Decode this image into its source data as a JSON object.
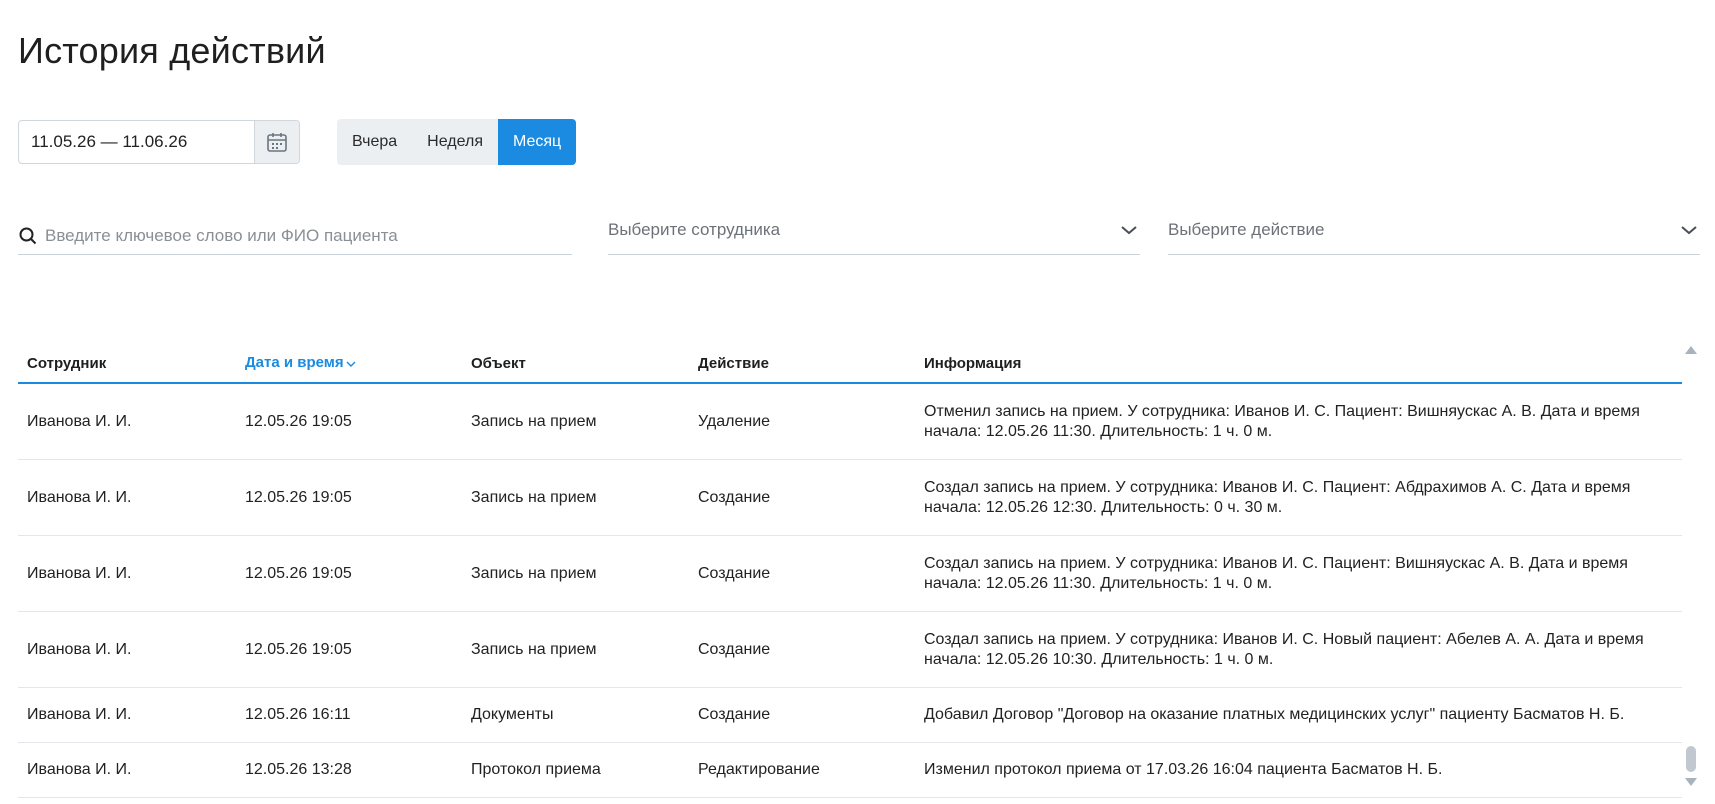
{
  "page": {
    "title": "История действий"
  },
  "filters": {
    "date_range": "11.05.26 — 11.06.26",
    "periods": [
      {
        "label": "Вчера",
        "active": false
      },
      {
        "label": "Неделя",
        "active": false
      },
      {
        "label": "Месяц",
        "active": true
      }
    ],
    "search_placeholder": "Введите ключевое слово или ФИО пациента",
    "employee_placeholder": "Выберите сотрудника",
    "action_placeholder": "Выберите действие"
  },
  "table": {
    "headers": {
      "employee": "Сотрудник",
      "datetime": "Дата и время",
      "object": "Объект",
      "action": "Действие",
      "info": "Информация"
    },
    "rows": [
      {
        "employee": "Иванова И. И.",
        "datetime": "12.05.26 19:05",
        "object": "Запись на прием",
        "action": "Удаление",
        "info": "Отменил запись на прием. У сотрудника: Иванов И. С. Пациент: Вишняускас А. В. Дата и время начала: 12.05.26 11:30. Длительность: 1 ч. 0 м."
      },
      {
        "employee": "Иванова И. И.",
        "datetime": "12.05.26 19:05",
        "object": "Запись на прием",
        "action": "Создание",
        "info": "Создал запись на прием. У сотрудника: Иванов И. С. Пациент: Абдрахимов А. С. Дата и время начала: 12.05.26 12:30. Длительность: 0 ч. 30 м."
      },
      {
        "employee": "Иванова И. И.",
        "datetime": "12.05.26 19:05",
        "object": "Запись на прием",
        "action": "Создание",
        "info": "Создал запись на прием. У сотрудника: Иванов И. С. Пациент: Вишняускас А. В. Дата и время начала: 12.05.26 11:30. Длительность: 1 ч. 0 м."
      },
      {
        "employee": "Иванова И. И.",
        "datetime": "12.05.26 19:05",
        "object": "Запись на прием",
        "action": "Создание",
        "info": "Создал запись на прием. У сотрудника: Иванов И. С. Новый пациент: Абелев А. А. Дата и время начала: 12.05.26 10:30. Длительность: 1 ч. 0 м."
      },
      {
        "employee": "Иванова И. И.",
        "datetime": "12.05.26 16:11",
        "object": "Документы",
        "action": "Создание",
        "info": "Добавил Договор \"Договор на оказание платных медицинских услуг\" пациенту Басматов Н. Б."
      },
      {
        "employee": "Иванова И. И.",
        "datetime": "12.05.26 13:28",
        "object": "Протокол приема",
        "action": "Редактирование",
        "info": "Изменил протокол приема от 17.03.26 16:04 пациента Басматов Н. Б."
      }
    ]
  },
  "colors": {
    "accent": "#1a8be0",
    "segment_bg": "#eceff2",
    "divider": "#e3e7eb"
  },
  "icons": {
    "calendar": "calendar-icon",
    "search": "search-icon",
    "chevron": "chevron-down-icon",
    "sort": "sort-desc-icon"
  }
}
